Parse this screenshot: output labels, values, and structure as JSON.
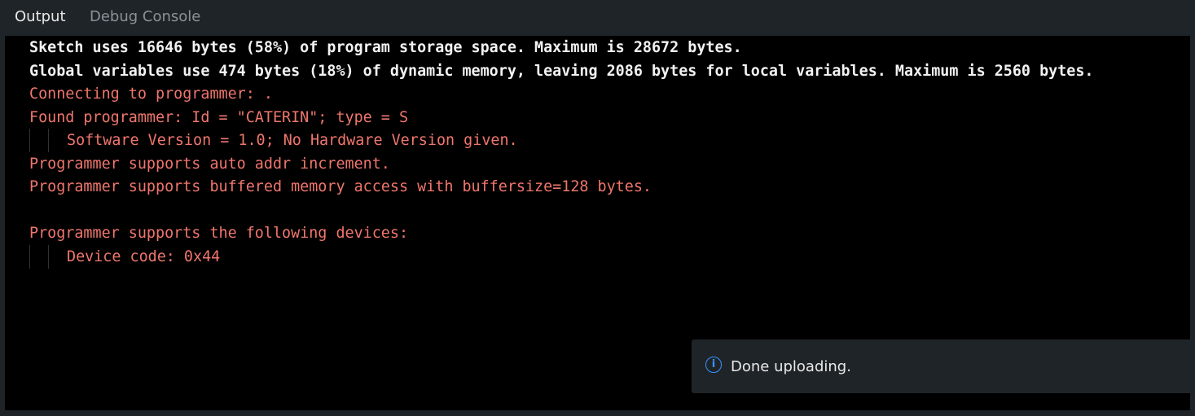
{
  "tabs": {
    "output": "Output",
    "debug_console": "Debug Console"
  },
  "output_lines": [
    "Sketch uses 16646 bytes (58%) of program storage space. Maximum is 28672 bytes.",
    "Global variables use 474 bytes (18%) of dynamic memory, leaving 2086 bytes for local variables. Maximum is 2560 bytes.",
    "Connecting to programmer: .",
    "Found programmer: Id = \"CATERIN\"; type = S",
    "Software Version = 1.0; No Hardware Version given.",
    "Programmer supports auto addr increment.",
    "Programmer supports buffered memory access with buffersize=128 bytes.",
    "",
    "Programmer supports the following devices:",
    "Device code: 0x44"
  ],
  "notification": {
    "icon": "info-icon",
    "message": "Done uploading."
  },
  "colors": {
    "background": "#000000",
    "chrome": "#1f2428",
    "stdout": "#f2f2f2",
    "stderr": "#f0766d",
    "info_icon": "#3794ff"
  }
}
